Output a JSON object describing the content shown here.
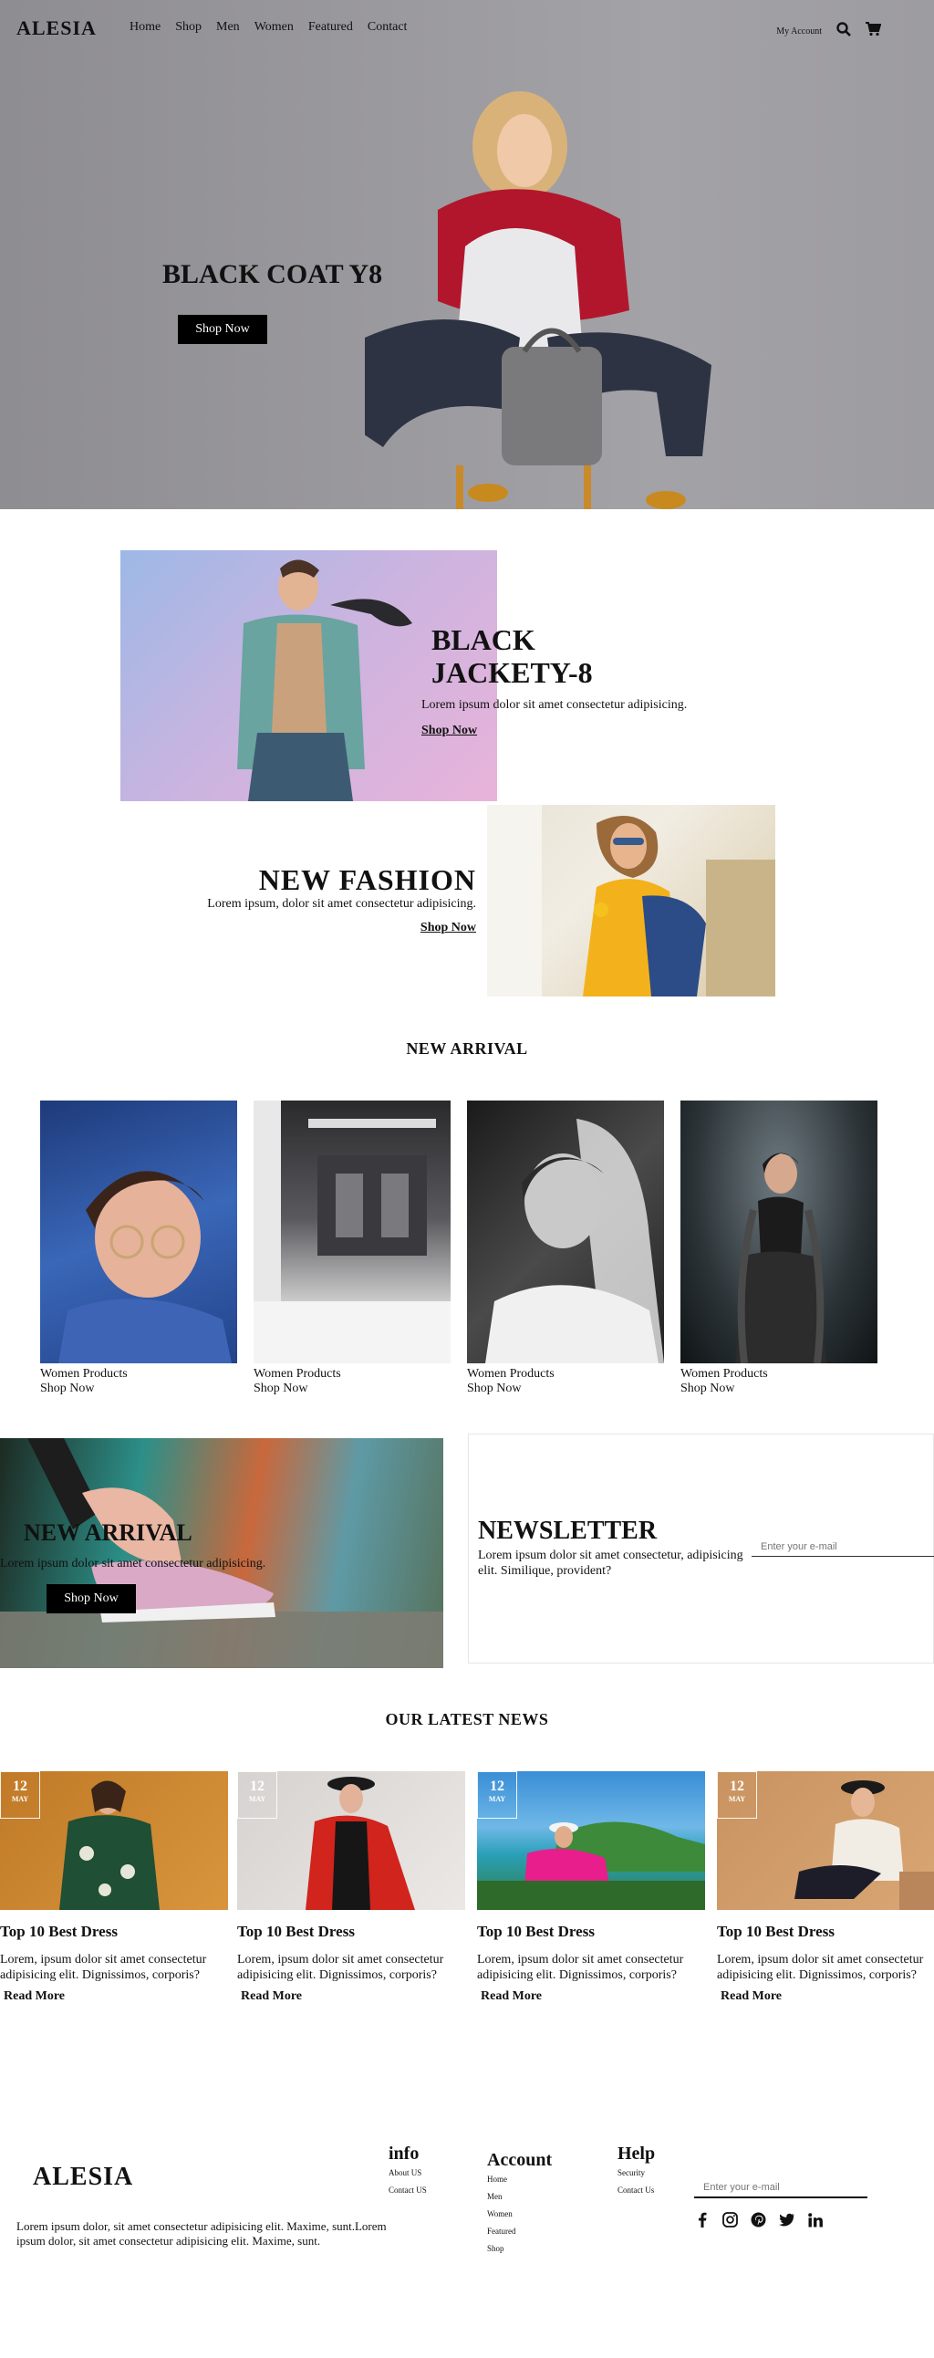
{
  "header": {
    "logo": "ALESIA",
    "menu": [
      "Home",
      "Shop",
      "Men",
      "Women",
      "Featured",
      "Contact"
    ],
    "my_account": "My Account"
  },
  "hero": {
    "title": "BLACK COAT Y8",
    "button": "Shop Now"
  },
  "promo1": {
    "title_line1": "BLACK",
    "title_line2": "JACKETY-8",
    "desc": "Lorem ipsum dolor sit amet consectetur adipisicing.",
    "link": "Shop Now"
  },
  "promo2": {
    "title": "NEW FASHION",
    "desc": "Lorem ipsum, dolor sit amet consectetur adipisicing.",
    "link": "Shop Now"
  },
  "new_arrival": {
    "title": "NEW ARRIVAL",
    "products": [
      {
        "name": "Women Products",
        "link": "Shop Now"
      },
      {
        "name": "Women Products",
        "link": "Shop Now"
      },
      {
        "name": "Women Products",
        "link": "Shop Now"
      },
      {
        "name": "Women Products",
        "link": "Shop Now"
      }
    ]
  },
  "banner": {
    "title": "NEW ARRIVAL",
    "desc": "Lorem ipsum dolor sit amet consectetur adipisicing.",
    "button": "Shop Now"
  },
  "newsletter": {
    "title": "NEWSLETTER",
    "desc": "Lorem ipsum dolor sit amet consectetur, adipisicing elit. Similique, provident?",
    "placeholder": "Enter your e-mail"
  },
  "news": {
    "title": "OUR LATEST NEWS",
    "items": [
      {
        "day": "12",
        "month": "MAY",
        "title": "Top 10 Best Dress",
        "desc": "Lorem, ipsum dolor sit amet consectetur adipisicing elit. Dignissimos, corporis?",
        "link": "Read More"
      },
      {
        "day": "12",
        "month": "MAY",
        "title": "Top 10 Best Dress",
        "desc": "Lorem, ipsum dolor sit amet consectetur adipisicing elit. Dignissimos, corporis?",
        "link": "Read More"
      },
      {
        "day": "12",
        "month": "MAY",
        "title": "Top 10 Best Dress",
        "desc": "Lorem, ipsum dolor sit amet consectetur adipisicing elit. Dignissimos, corporis?",
        "link": "Read More"
      },
      {
        "day": "12",
        "month": "MAY",
        "title": "Top 10 Best Dress",
        "desc": "Lorem, ipsum dolor sit amet consectetur adipisicing elit. Dignissimos, corporis?",
        "link": "Read More"
      }
    ]
  },
  "footer": {
    "logo": "ALESIA",
    "text": "Lorem ipsum dolor, sit amet consectetur adipisicing elit. Maxime, sunt.Lorem ipsum dolor, sit amet consectetur adipisicing elit. Maxime, sunt.",
    "info": {
      "title": "info",
      "links": [
        "About US",
        "Contact US"
      ]
    },
    "account": {
      "title": "Account",
      "links": [
        "Home",
        "Men",
        "Women",
        "Featured",
        "Shop"
      ]
    },
    "help": {
      "title": "Help",
      "links": [
        "Security",
        "Contact Us"
      ]
    },
    "email_placeholder": "Enter your e-mail",
    "social_icons": [
      "facebook-icon",
      "instagram-icon",
      "pinterest-icon",
      "twitter-icon",
      "linkedin-icon"
    ]
  }
}
